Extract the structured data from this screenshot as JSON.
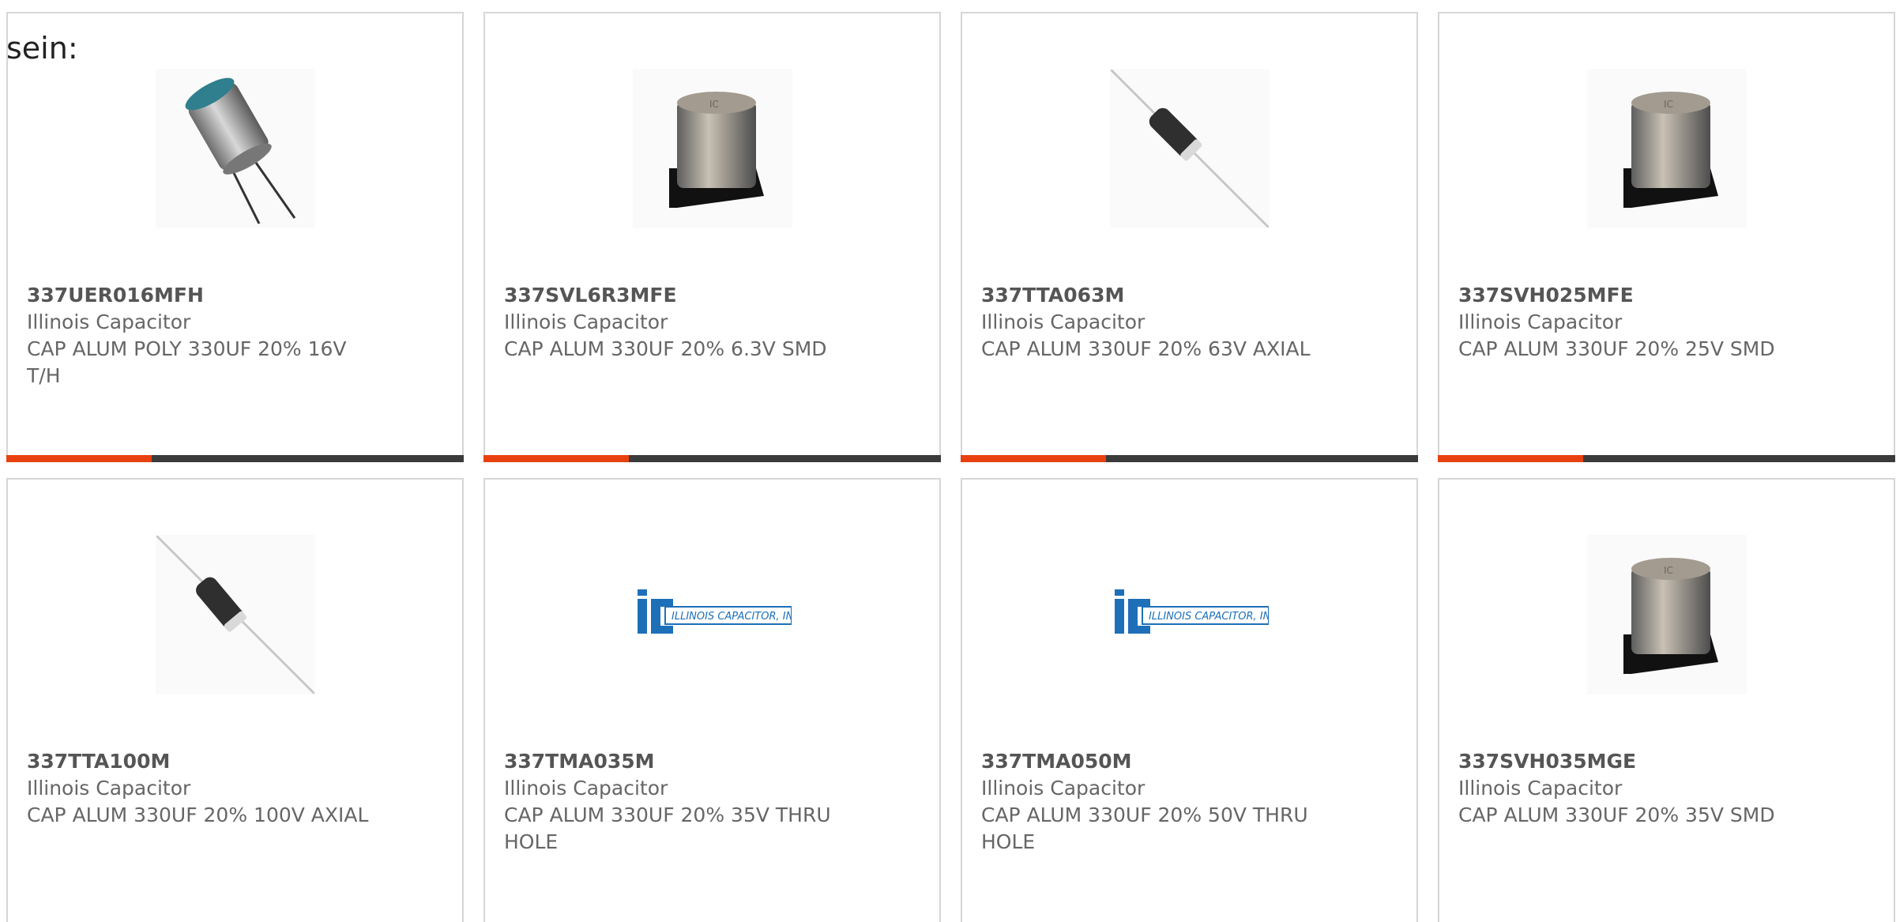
{
  "stray_text": "sein:",
  "colors": {
    "accent": "#e8410f",
    "bar": "#3b3b3b",
    "border": "#d6d6d6",
    "logo_blue": "#1d6fb8"
  },
  "products": [
    {
      "part": "337UER016MFH",
      "manufacturer": "Illinois Capacitor",
      "description": "CAP ALUM POLY 330UF 20% 16V T/H",
      "image": "radial-capacitor-icon"
    },
    {
      "part": "337SVL6R3MFE",
      "manufacturer": "Illinois Capacitor",
      "description": "CAP ALUM 330UF 20% 6.3V SMD",
      "image": "smd-capacitor-icon"
    },
    {
      "part": "337TTA063M",
      "manufacturer": "Illinois Capacitor",
      "description": "CAP ALUM 330UF 20% 63V AXIAL",
      "image": "axial-capacitor-icon"
    },
    {
      "part": "337SVH025MFE",
      "manufacturer": "Illinois Capacitor",
      "description": "CAP ALUM 330UF 20% 25V SMD",
      "image": "smd-capacitor-icon"
    },
    {
      "part": "337TTA100M",
      "manufacturer": "Illinois Capacitor",
      "description": "CAP ALUM 330UF 20% 100V AXIAL",
      "image": "axial-capacitor-icon"
    },
    {
      "part": "337TMA035M",
      "manufacturer": "Illinois Capacitor",
      "description": "CAP ALUM 330UF 20% 35V THRU HOLE",
      "image": "illinois-capacitor-logo",
      "logo_text": "ILLINOIS CAPACITOR, INC."
    },
    {
      "part": "337TMA050M",
      "manufacturer": "Illinois Capacitor",
      "description": "CAP ALUM 330UF 20% 50V THRU HOLE",
      "image": "illinois-capacitor-logo",
      "logo_text": "ILLINOIS CAPACITOR, INC."
    },
    {
      "part": "337SVH035MGE",
      "manufacturer": "Illinois Capacitor",
      "description": "CAP ALUM 330UF 20% 35V SMD",
      "image": "smd-capacitor-icon"
    }
  ]
}
